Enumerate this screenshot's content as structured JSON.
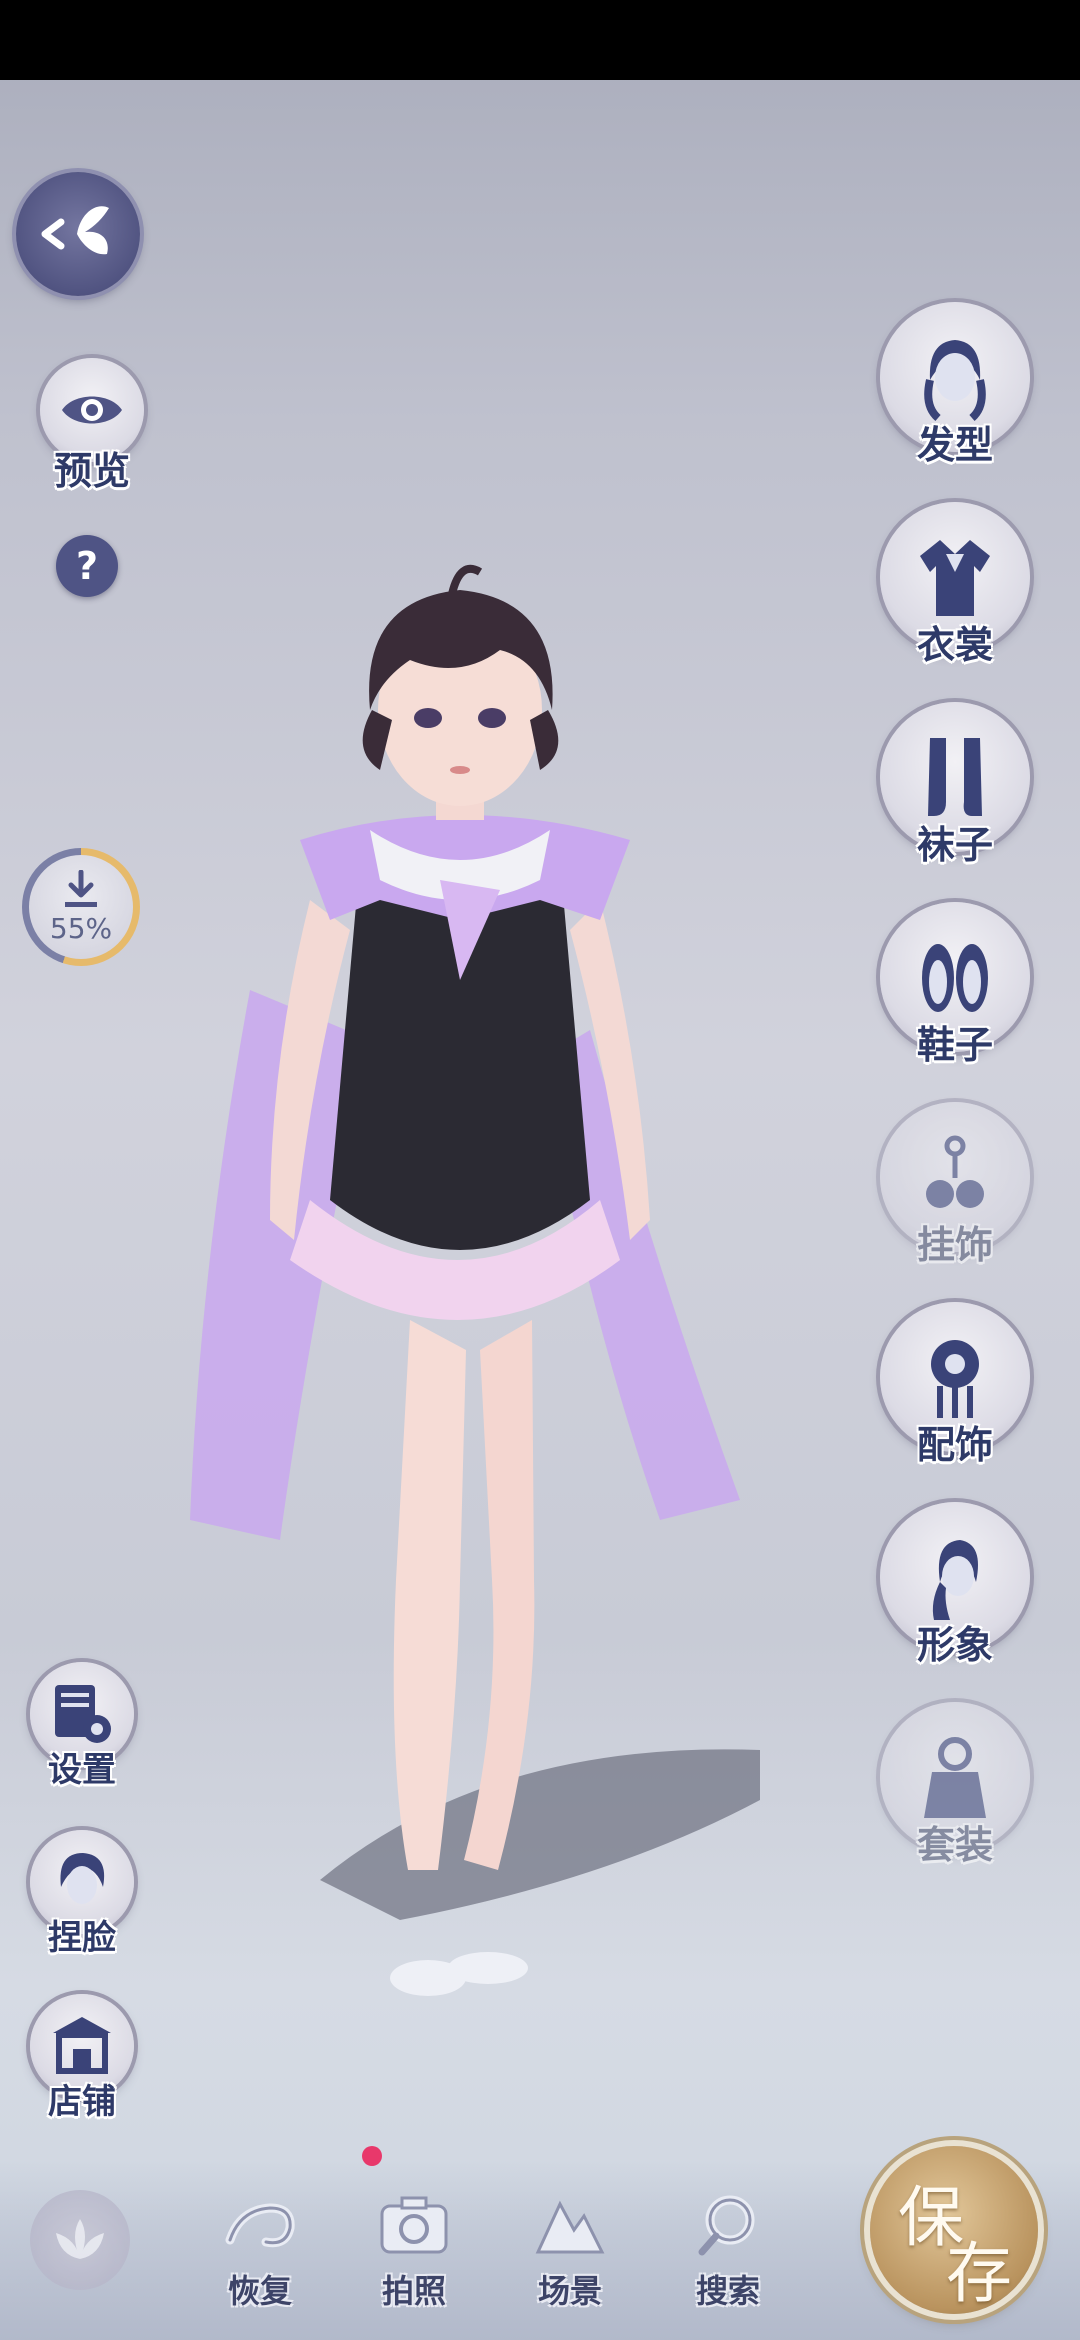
{
  "left_controls": {
    "preview_label": "预览",
    "help_label": "?",
    "download_percent": "55%",
    "download_progress": 0.55,
    "settings_label": "设置",
    "face_label": "捏脸",
    "shop_label": "店铺"
  },
  "right_menu": [
    {
      "label": "发型",
      "icon": "hairstyle-icon",
      "enabled": true
    },
    {
      "label": "衣裳",
      "icon": "clothes-icon",
      "enabled": true
    },
    {
      "label": "袜子",
      "icon": "socks-icon",
      "enabled": true
    },
    {
      "label": "鞋子",
      "icon": "shoes-icon",
      "enabled": true
    },
    {
      "label": "挂饰",
      "icon": "pendant-icon",
      "enabled": false
    },
    {
      "label": "配饰",
      "icon": "accessory-icon",
      "enabled": true
    },
    {
      "label": "形象",
      "icon": "appearance-icon",
      "enabled": true
    },
    {
      "label": "套装",
      "icon": "outfit-set-icon",
      "enabled": false
    }
  ],
  "bottom_tabs": [
    {
      "label": "恢复",
      "icon": "restore-icon"
    },
    {
      "label": "拍照",
      "icon": "camera-icon"
    },
    {
      "label": "场景",
      "icon": "scene-icon"
    },
    {
      "label": "搜索",
      "icon": "search-icon"
    }
  ],
  "save_button": {
    "char1": "保",
    "char2": "存"
  },
  "colors": {
    "label_text": "#2e3a68",
    "accent_gold": "#e6ba6b",
    "notify_dot": "#e8386b",
    "outfit_purple": "#c9a8ef"
  }
}
